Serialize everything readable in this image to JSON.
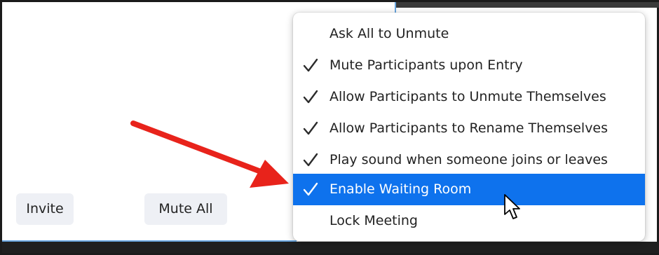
{
  "buttons": {
    "invite": "Invite",
    "mute_all": "Mute All"
  },
  "menu": {
    "items": [
      {
        "label": "Ask All to Unmute",
        "checked": false,
        "selected": false
      },
      {
        "label": "Mute Participants upon Entry",
        "checked": true,
        "selected": false
      },
      {
        "label": "Allow Participants to Unmute Themselves",
        "checked": true,
        "selected": false
      },
      {
        "label": "Allow Participants to Rename Themselves",
        "checked": true,
        "selected": false
      },
      {
        "label": "Play sound when someone joins or leaves",
        "checked": true,
        "selected": false
      },
      {
        "label": "Enable Waiting Room",
        "checked": true,
        "selected": true
      },
      {
        "label": "Lock Meeting",
        "checked": false,
        "selected": false
      }
    ]
  },
  "colors": {
    "selected_bg": "#0e72ed",
    "annotation_arrow": "#e8231b"
  }
}
